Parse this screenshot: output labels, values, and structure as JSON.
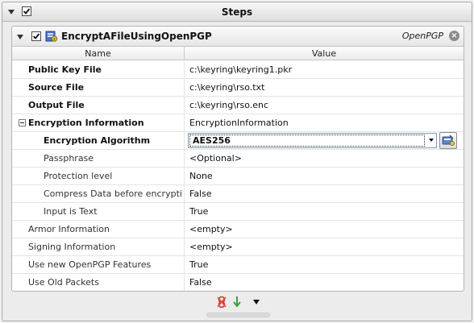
{
  "steps": {
    "title": "Steps",
    "step": {
      "name": "EncryptAFileUsingOpenPGP",
      "type": "OpenPGP",
      "columns": {
        "name": "Name",
        "value": "Value"
      },
      "rows": [
        {
          "name": "Public Key File",
          "value": "c:\\keyring\\keyring1.pkr"
        },
        {
          "name": "Source File",
          "value": "c:\\keyring\\rso.txt"
        },
        {
          "name": "Output File",
          "value": "c:\\keyring\\rso.enc"
        },
        {
          "name": "Encryption Information",
          "value": "EncryptionInformation"
        },
        {
          "name": "Encryption Algorithm",
          "value": "AES256"
        },
        {
          "name": "Passphrase",
          "value": "<Optional>"
        },
        {
          "name": "Protection level",
          "value": "None"
        },
        {
          "name": "Compress Data before encryptio",
          "value": "False"
        },
        {
          "name": "Input is Text",
          "value": "True"
        },
        {
          "name": "Armor Information",
          "value": "<empty>"
        },
        {
          "name": "Signing Information",
          "value": "<empty>"
        },
        {
          "name": "Use new OpenPGP Features",
          "value": "True"
        },
        {
          "name": "Use Old Packets",
          "value": "False"
        }
      ]
    }
  },
  "icons": {
    "collapse": "collapse-triangle-icon",
    "checkbox": "checkmark-icon",
    "step": "openpgp-step-icon",
    "close": "close-circle-icon",
    "remove": "remove-step-icon",
    "move_down": "move-down-arrow-icon",
    "more": "dropdown-triangle-icon",
    "edit": "edit-value-icon"
  }
}
